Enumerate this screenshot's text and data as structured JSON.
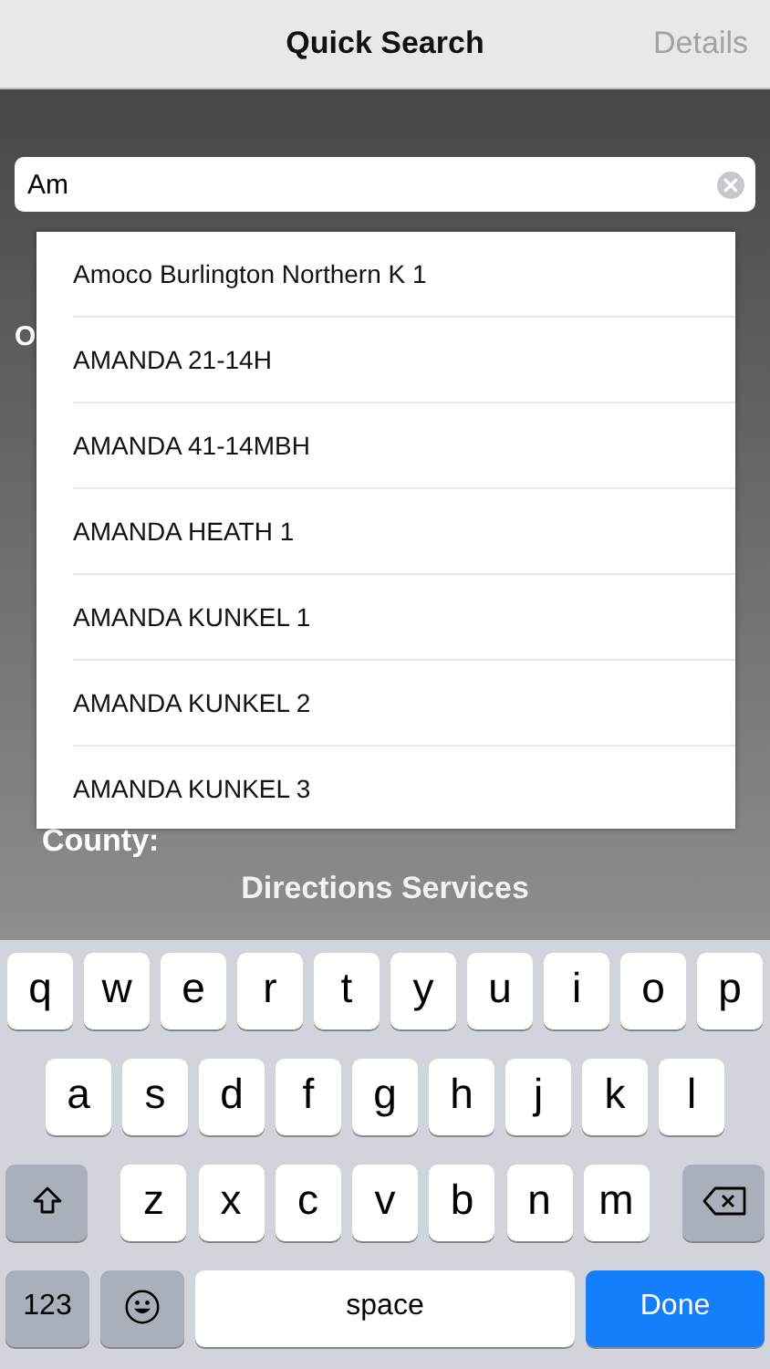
{
  "nav_bar": {
    "title": "Quick Search",
    "action": {
      "label": "Details",
      "disabled": true
    }
  },
  "search": {
    "value": "Am"
  },
  "form_labels": [
    {
      "text": "O"
    },
    {
      "text": "County:"
    }
  ],
  "suggestions": [
    "Amoco Burlington Northern K 1",
    "AMANDA 21-14H",
    "AMANDA 41-14MBH",
    "AMANDA HEATH 1",
    "AMANDA KUNKEL 1",
    "AMANDA KUNKEL 2",
    "AMANDA KUNKEL 3"
  ],
  "section_button": "Directions Services",
  "keyboard": {
    "rows": [
      {
        "keys": [
          {
            "kind": "letter",
            "label": "q"
          },
          {
            "kind": "letter",
            "label": "w"
          },
          {
            "kind": "letter",
            "label": "e"
          },
          {
            "kind": "letter",
            "label": "r"
          },
          {
            "kind": "letter",
            "label": "t"
          },
          {
            "kind": "letter",
            "label": "y"
          },
          {
            "kind": "letter",
            "label": "u"
          },
          {
            "kind": "letter",
            "label": "i"
          },
          {
            "kind": "letter",
            "label": "o"
          },
          {
            "kind": "letter",
            "label": "p"
          }
        ]
      },
      {
        "keys": [
          {
            "kind": "letter",
            "label": "a"
          },
          {
            "kind": "letter",
            "label": "s"
          },
          {
            "kind": "letter",
            "label": "d"
          },
          {
            "kind": "letter",
            "label": "f"
          },
          {
            "kind": "letter",
            "label": "g"
          },
          {
            "kind": "letter",
            "label": "h"
          },
          {
            "kind": "letter",
            "label": "j"
          },
          {
            "kind": "letter",
            "label": "k"
          },
          {
            "kind": "letter",
            "label": "l"
          }
        ]
      },
      {
        "keys": [
          {
            "kind": "shift"
          },
          {
            "kind": "letter",
            "label": "z"
          },
          {
            "kind": "letter",
            "label": "x"
          },
          {
            "kind": "letter",
            "label": "c"
          },
          {
            "kind": "letter",
            "label": "v"
          },
          {
            "kind": "letter",
            "label": "b"
          },
          {
            "kind": "letter",
            "label": "n"
          },
          {
            "kind": "letter",
            "label": "m"
          },
          {
            "kind": "delete"
          }
        ]
      },
      {
        "keys": [
          {
            "kind": "numbers",
            "label": "123"
          },
          {
            "kind": "emoji"
          },
          {
            "kind": "space",
            "label": "space"
          },
          {
            "kind": "done",
            "label": "Done"
          }
        ]
      }
    ]
  }
}
